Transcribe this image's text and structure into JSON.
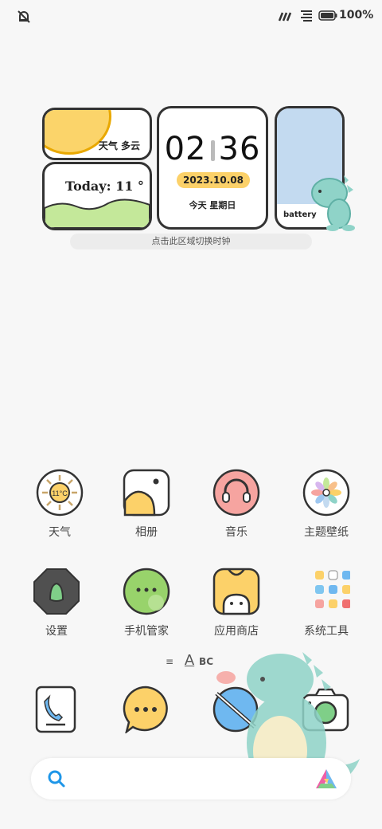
{
  "status_bar": {
    "battery_percent": "100%"
  },
  "widgets": {
    "weather_text": "天气 多云",
    "today_text": "Today:  11 °",
    "clock_hour": "02",
    "clock_minute": "36",
    "date": "2023.10.08",
    "day": "今天   星期日",
    "battery_label": "battery",
    "hint": "点击此区域切换时钟"
  },
  "apps": {
    "row1": [
      {
        "label": "天气",
        "icon": "weather-icon",
        "temp": "11°C"
      },
      {
        "label": "相册",
        "icon": "gallery-icon"
      },
      {
        "label": "音乐",
        "icon": "music-icon"
      },
      {
        "label": "主题壁纸",
        "icon": "themes-icon"
      }
    ],
    "row2": [
      {
        "label": "设置",
        "icon": "settings-icon"
      },
      {
        "label": "手机管家",
        "icon": "security-icon"
      },
      {
        "label": "应用商店",
        "icon": "app-store-icon"
      },
      {
        "label": "系统工具",
        "icon": "tools-folder-icon"
      }
    ]
  },
  "page_indicator": {
    "menu_glyph": "≡",
    "abc_glyph": "A",
    "abc_text": "BC"
  },
  "dock": [
    "phone-icon",
    "messages-icon",
    "browser-icon",
    "camera-icon"
  ],
  "colors": {
    "accent_yellow": "#fcd169",
    "sky_blue": "#c3daf0",
    "grass_green": "#c4e89a",
    "search_blue": "#1e96e8"
  }
}
